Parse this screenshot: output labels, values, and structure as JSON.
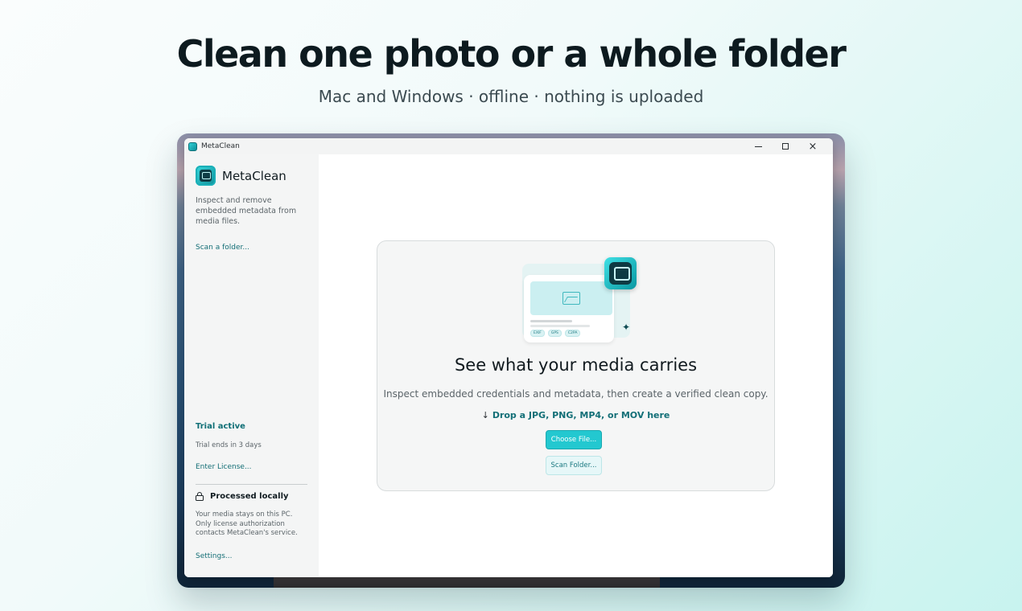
{
  "hero": {
    "title": "Clean one photo or a whole folder",
    "subtitle": "Mac and Windows · offline · nothing is uploaded"
  },
  "window": {
    "title": "MetaClean",
    "controls": {
      "minimize": "minimize-icon",
      "maximize": "maximize-icon",
      "close": "×"
    }
  },
  "sidebar": {
    "app_name": "MetaClean",
    "description": "Inspect and remove embedded metadata from media files.",
    "scan_folder_link": "Scan a folder...",
    "trial_title": "Trial active",
    "trial_ends": "Trial ends in 3 days",
    "enter_license_link": "Enter License...",
    "local_title": "Processed locally",
    "local_desc": "Your media stays on this PC. Only license authorization contacts MetaClean's service.",
    "settings_link": "Settings..."
  },
  "main": {
    "illustration_tags": [
      "EXIF",
      "GPS",
      "C2PA"
    ],
    "title": "See what your media carries",
    "description": "Inspect embedded credentials and metadata, then create a verified clean copy.",
    "drop_arrow": "↓",
    "drop_hint": "Drop a JPG, PNG, MP4, or MOV here",
    "choose_file_button": "Choose File...",
    "scan_folder_button": "Scan Folder..."
  },
  "colors": {
    "accent": "#23c8d0",
    "accent_dark": "#126f77",
    "sidebar_bg": "#f4f5f5"
  }
}
